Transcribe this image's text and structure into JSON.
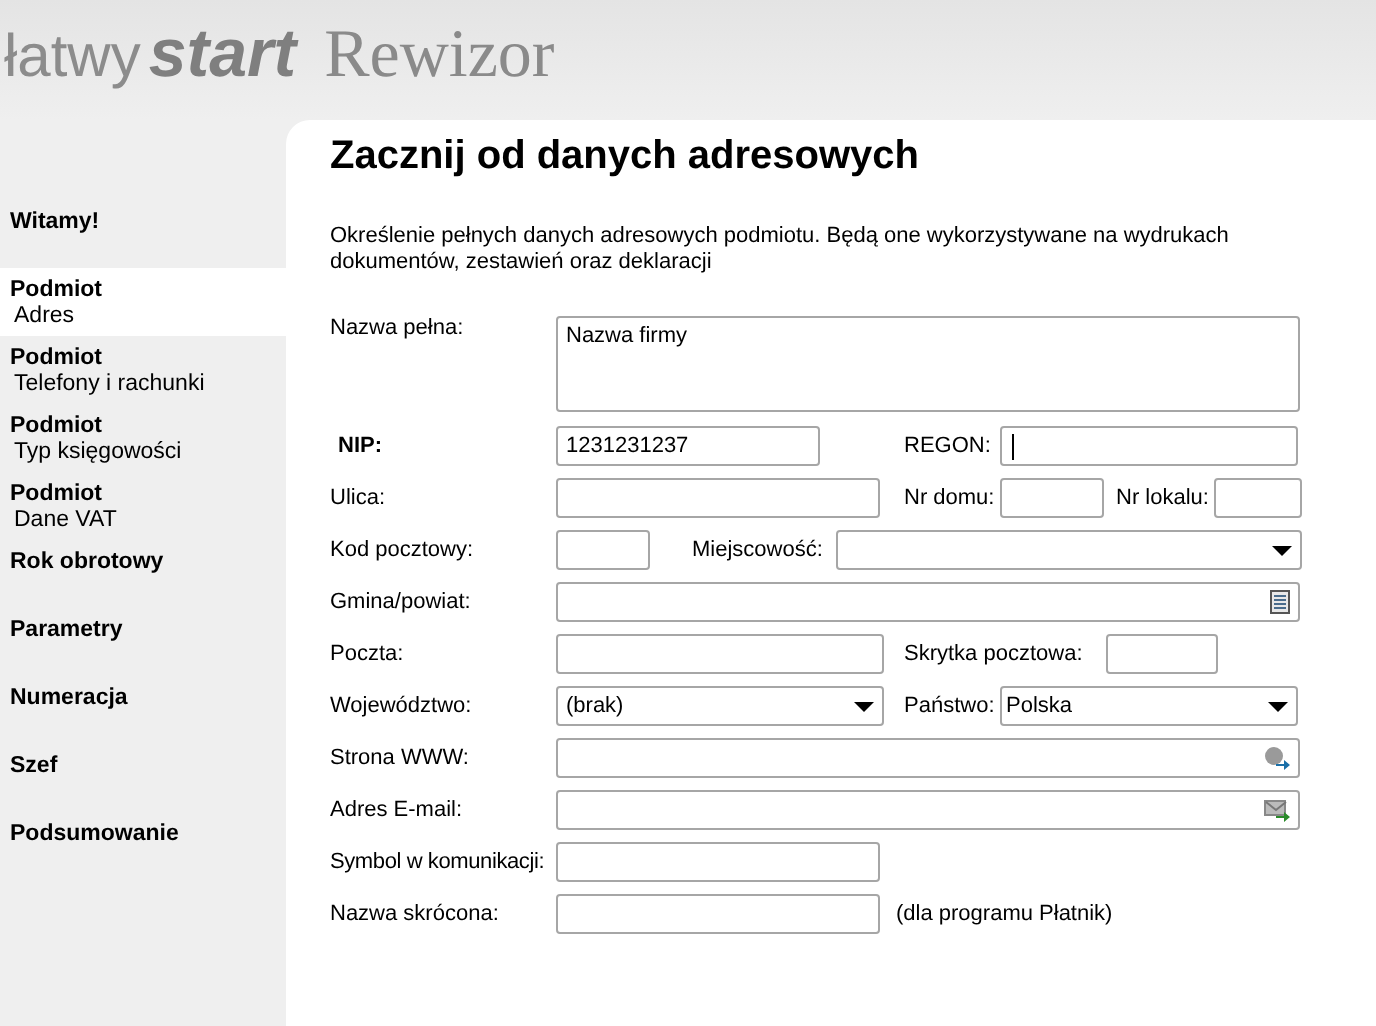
{
  "header": {
    "logo_lines": [
      "łatwy",
      "start",
      "Rewizor"
    ]
  },
  "sidebar": {
    "items": [
      {
        "title": "Witamy!",
        "selected": false
      },
      {
        "title": "Podmiot",
        "subtitle": "Adres",
        "selected": true
      },
      {
        "title": "Podmiot",
        "subtitle": "Telefony i rachunki",
        "selected": false
      },
      {
        "title": "Podmiot",
        "subtitle": "Typ księgowości",
        "selected": false
      },
      {
        "title": "Podmiot",
        "subtitle": "Dane VAT",
        "selected": false
      },
      {
        "title": "Rok obrotowy",
        "selected": false
      },
      {
        "title": "Parametry",
        "selected": false
      },
      {
        "title": "Numeracja",
        "selected": false
      },
      {
        "title": "Szef",
        "selected": false
      },
      {
        "title": "Podsumowanie",
        "selected": false
      }
    ]
  },
  "page": {
    "title": "Zacznij od danych adresowych",
    "description": "Określenie pełnych danych adresowych podmiotu. Będą one wykorzystywane na wydrukach dokumentów, zestawień oraz deklaracji"
  },
  "form": {
    "rows": [
      {
        "items": [
          {
            "kind": "label",
            "text": "Nazwa pełna:",
            "bold": false
          },
          {
            "kind": "textarea",
            "value": "Nazwa firmy",
            "focused": false
          }
        ]
      },
      {
        "items": [
          {
            "kind": "label",
            "text": "NIP:",
            "bold": true
          },
          {
            "kind": "text",
            "value": "1231231237",
            "focused": false
          },
          {
            "kind": "label",
            "text": "REGON:",
            "bold": false
          },
          {
            "kind": "text",
            "focused": true
          }
        ]
      },
      {
        "items": [
          {
            "kind": "label",
            "text": "Ulica:",
            "bold": false
          },
          {
            "kind": "text",
            "focused": false
          },
          {
            "kind": "label",
            "text": "Nr domu:",
            "bold": false
          },
          {
            "kind": "text",
            "focused": false
          },
          {
            "kind": "label",
            "text": "Nr lokalu:",
            "bold": false
          },
          {
            "kind": "text",
            "focused": false
          }
        ]
      },
      {
        "items": [
          {
            "kind": "label",
            "text": "Kod pocztowy:",
            "bold": false
          },
          {
            "kind": "text",
            "focused": false
          },
          {
            "kind": "label",
            "text": "Miejscowość:",
            "bold": false
          },
          {
            "kind": "select",
            "focused": false
          }
        ]
      },
      {
        "items": [
          {
            "kind": "label",
            "text": "Gmina/powiat:",
            "bold": false
          },
          {
            "kind": "picker",
            "focused": false
          }
        ]
      },
      {
        "items": [
          {
            "kind": "label",
            "text": "Poczta:",
            "bold": false
          },
          {
            "kind": "text",
            "focused": false
          },
          {
            "kind": "label",
            "text": "Skrytka pocztowa:",
            "bold": false
          },
          {
            "kind": "text",
            "focused": false
          }
        ]
      },
      {
        "items": [
          {
            "kind": "label",
            "text": "Województwo:",
            "bold": false
          },
          {
            "kind": "select",
            "value": "(brak)",
            "focused": false
          },
          {
            "kind": "label",
            "text": "Państwo:",
            "bold": false
          },
          {
            "kind": "select",
            "value": "Polska",
            "focused": false
          }
        ]
      },
      {
        "items": [
          {
            "kind": "label",
            "text": "Strona WWW:",
            "bold": false
          },
          {
            "kind": "web",
            "focused": false
          }
        ]
      },
      {
        "items": [
          {
            "kind": "label",
            "text": "Adres E-mail:",
            "bold": false
          },
          {
            "kind": "email",
            "focused": false
          }
        ]
      },
      {
        "items": [
          {
            "kind": "label",
            "text": "Symbol w komunikacji:",
            "bold": false
          },
          {
            "kind": "text",
            "focused": false
          }
        ]
      },
      {
        "items": [
          {
            "kind": "label",
            "text": "Nazwa skrócona:",
            "bold": false
          },
          {
            "kind": "text",
            "focused": false
          },
          {
            "kind": "note",
            "text": "(dla programu Płatnik)"
          }
        ]
      }
    ]
  }
}
